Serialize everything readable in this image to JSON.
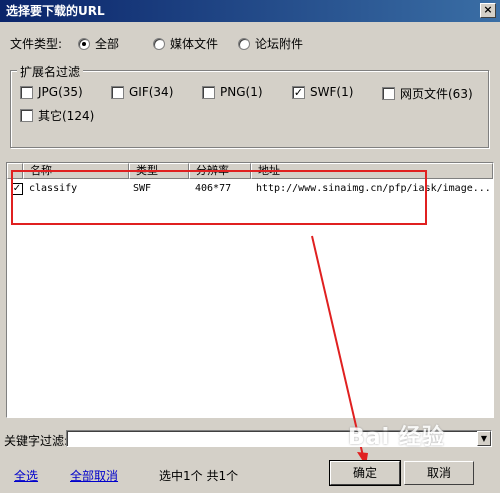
{
  "window": {
    "title": "选择要下载的URL",
    "close_glyph": "×"
  },
  "filetype": {
    "label": "文件类型:",
    "options": [
      {
        "label": "全部",
        "selected": true
      },
      {
        "label": "媒体文件",
        "selected": false
      },
      {
        "label": "论坛附件",
        "selected": false
      }
    ]
  },
  "ext_filter": {
    "legend": "扩展名过滤",
    "items": [
      {
        "label": "JPG(35)",
        "checked": false
      },
      {
        "label": "GIF(34)",
        "checked": false
      },
      {
        "label": "PNG(1)",
        "checked": false
      },
      {
        "label": "SWF(1)",
        "checked": true
      },
      {
        "label": "网页文件(63)",
        "checked": false
      },
      {
        "label": "其它(124)",
        "checked": false
      }
    ]
  },
  "list": {
    "columns": [
      "名称",
      "类型",
      "分辨率",
      "地址"
    ],
    "rows": [
      {
        "checked": true,
        "name": "classify",
        "type": "SWF",
        "resolution": "406*77",
        "address": "http://www.sinaimg.cn/pfp/iask/image..."
      }
    ]
  },
  "keyword": {
    "label": "关键字过滤:",
    "value": ""
  },
  "footer": {
    "select_all": "全选",
    "deselect_all": "全部取消",
    "status": "选中1个  共1个",
    "ok": "确定",
    "cancel": "取消"
  },
  "watermark": "Bai 经验",
  "colors": {
    "annotation": "#e02020",
    "title_bg": "#0a246a",
    "link": "#0000cc"
  }
}
